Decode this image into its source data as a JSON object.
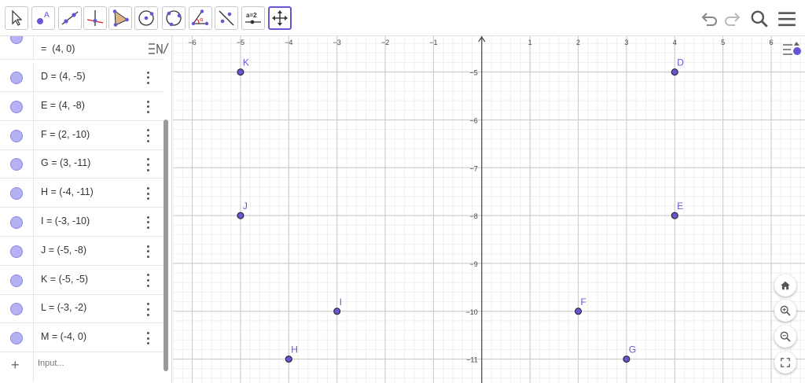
{
  "toolbar": {
    "tools": [
      {
        "name": "move-tool-icon"
      },
      {
        "name": "point-tool-icon",
        "label": "A"
      },
      {
        "name": "line-tool-icon"
      },
      {
        "name": "perpendicular-tool-icon"
      },
      {
        "name": "polygon-tool-icon"
      },
      {
        "name": "circle-center-tool-icon"
      },
      {
        "name": "circle-three-points-tool-icon"
      },
      {
        "name": "angle-tool-icon",
        "label": "α"
      },
      {
        "name": "reflect-tool-icon"
      },
      {
        "name": "slider-tool-icon",
        "label": "a=2"
      },
      {
        "name": "move-graphics-tool-icon"
      }
    ],
    "right": [
      "undo-icon",
      "redo-icon",
      "search-icon",
      "hamburger-menu-icon"
    ]
  },
  "algebra": {
    "partial_row": "=  (4, 0)",
    "rows": [
      {
        "text": "D = (4, -5)"
      },
      {
        "text": "E = (4, -8)"
      },
      {
        "text": "F = (2, -10)"
      },
      {
        "text": "G = (3, -11)"
      },
      {
        "text": "H = (-4, -11)"
      },
      {
        "text": "I = (-3, -10)"
      },
      {
        "text": "J = (-5, -8)"
      },
      {
        "text": "K = (-5, -5)"
      },
      {
        "text": "L = (-3, -2)"
      },
      {
        "text": "M = (-4, 0)"
      }
    ],
    "input_placeholder": "Input...",
    "add_symbol": "+"
  },
  "graphics": {
    "x_ticks": [
      -6,
      -5,
      -4,
      -3,
      -2,
      -1,
      1,
      2,
      3,
      4,
      5,
      6
    ],
    "y_ticks": [
      -5,
      -6,
      -7,
      -8,
      -9,
      -10,
      -11
    ],
    "xlim": [
      -6.4,
      6.7
    ],
    "ylim": [
      -11.5,
      -4.25
    ],
    "points": [
      {
        "label": "K",
        "x": -5,
        "y": -5
      },
      {
        "label": "D",
        "x": 4,
        "y": -5
      },
      {
        "label": "J",
        "x": -5,
        "y": -8
      },
      {
        "label": "E",
        "x": 4,
        "y": -8
      },
      {
        "label": "I",
        "x": -3,
        "y": -10
      },
      {
        "label": "F",
        "x": 2,
        "y": -10
      },
      {
        "label": "H",
        "x": -4,
        "y": -11
      },
      {
        "label": "G",
        "x": 3,
        "y": -11
      }
    ],
    "point_color": "#6557d2",
    "label_color": "#6557d2"
  },
  "colors": {
    "accent": "#6557d2",
    "marble": "#b5b2f3"
  }
}
